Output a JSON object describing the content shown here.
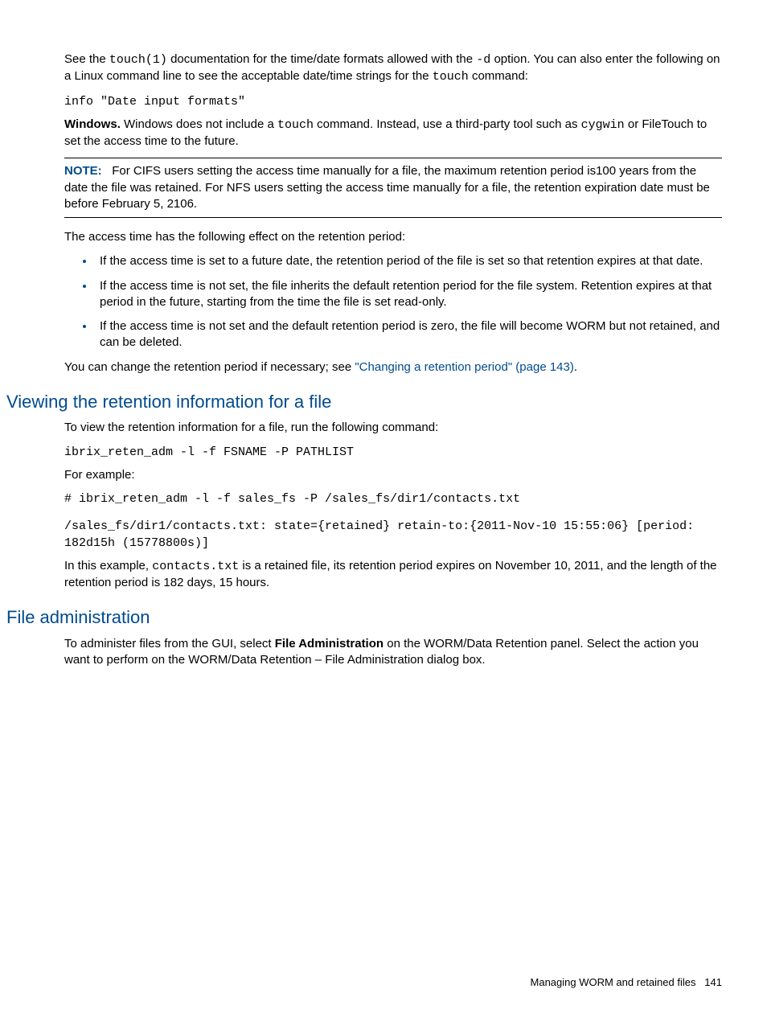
{
  "para1_a": "See the ",
  "para1_code1": "touch(1)",
  "para1_b": " documentation for the time/date formats allowed with the ",
  "para1_code2": "-d",
  "para1_c": " option. You can also enter the following on a Linux command line to see the acceptable date/time strings for the ",
  "para1_code3": "touch",
  "para1_d": " command:",
  "cmd1": "info \"Date input formats\"",
  "para2_label": "Windows.",
  "para2_a": " Windows does not include a ",
  "para2_code1": "touch",
  "para2_b": " command. Instead, use a third-party tool such as ",
  "para2_code2": "cygwin",
  "para2_c": " or FileTouch to set the access time to the future.",
  "note_label": "NOTE:",
  "note_text": "For CIFS users setting the access time manually for a file, the maximum retention period is100 years from the date the file was retained. For NFS users setting the access time manually for a file, the retention expiration date must be before February 5, 2106.",
  "para3": "The access time has the following effect on the retention period:",
  "bullet1": "If the access time is set to a future date, the retention period of the file is set so that retention expires at that date.",
  "bullet2": "If the access time is not set, the file inherits the default retention period for the file system. Retention expires at that period in the future, starting from the time the file is set read-only.",
  "bullet3": "If the access time is not set and the default retention period is zero, the file will become WORM but not retained, and can be deleted.",
  "para4_a": "You can change the retention period if necessary; see ",
  "para4_link": "\"Changing a retention period\" (page 143)",
  "para4_b": ".",
  "h2a": "Viewing the retention information for a file",
  "para5": "To view the retention information for a file, run the following command:",
  "cmd2": "ibrix_reten_adm -l -f FSNAME -P PATHLIST",
  "para6": "For example:",
  "cmd3": "# ibrix_reten_adm -l -f sales_fs -P /sales_fs/dir1/contacts.txt",
  "cmd4": "/sales_fs/dir1/contacts.txt: state={retained} retain-to:{2011-Nov-10 15:55:06} [period: 182d15h (15778800s)]",
  "para7_a": "In this example, ",
  "para7_code": "contacts.txt",
  "para7_b": " is a retained file, its retention period expires on November 10, 2011, and the length of the retention period is 182 days, 15 hours.",
  "h2b": "File administration",
  "para8_a": "To administer files from the GUI, select ",
  "para8_bold": "File Administration",
  "para8_b": " on the WORM/Data Retention panel. Select the action you want to perform on the WORM/Data Retention – File Administration dialog box.",
  "footer_text": "Managing WORM and retained files",
  "footer_page": "141"
}
